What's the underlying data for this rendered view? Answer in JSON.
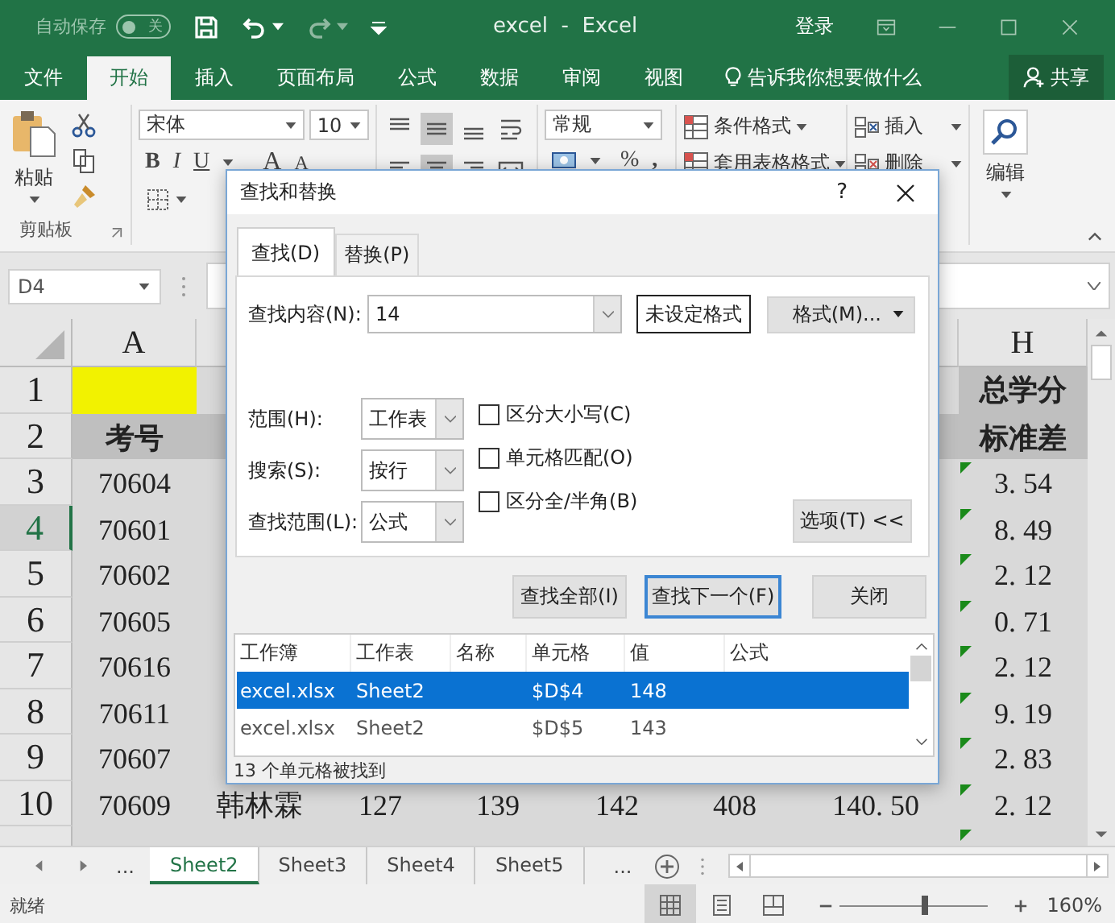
{
  "autosave": {
    "label": "自动保存",
    "on": false,
    "state_text": "关"
  },
  "window": {
    "title": "excel  -  Excel",
    "sign_in": "登录"
  },
  "tabs": [
    {
      "label": "文件",
      "selected": false
    },
    {
      "label": "开始",
      "selected": true
    },
    {
      "label": "插入",
      "selected": false
    },
    {
      "label": "页面布局",
      "selected": false
    },
    {
      "label": "公式",
      "selected": false
    },
    {
      "label": "数据",
      "selected": false
    },
    {
      "label": "审阅",
      "selected": false
    },
    {
      "label": "视图",
      "selected": false
    }
  ],
  "tell_me": "告诉我你想要做什么",
  "share": "共享",
  "ribbon": {
    "paste": "粘贴",
    "clipboard_label": "剪贴板",
    "font": "宋体",
    "font_size": "10",
    "bold": "B",
    "italic": "I",
    "underline": "U",
    "grow": "A",
    "shrink": "A",
    "alignment": [
      {
        "kind": "top",
        "selected": false
      },
      {
        "kind": "middle",
        "selected": true
      },
      {
        "kind": "bottom",
        "selected": false
      },
      {
        "kind": "wrap",
        "selected": false
      },
      {
        "kind": "left",
        "selected": false
      },
      {
        "kind": "center",
        "selected": true
      },
      {
        "kind": "right",
        "selected": false
      },
      {
        "kind": "merge",
        "selected": false
      }
    ],
    "number_format": "常规",
    "percent": "%",
    "comma": ",",
    "styles": [
      "条件格式",
      "套用表格格式"
    ],
    "cells": [
      "插入",
      "删除"
    ],
    "editing": "编辑"
  },
  "name_box": "D4",
  "sheet": {
    "column_headers": {
      "a": "A",
      "h": "H"
    },
    "rows": [
      {
        "number": "1",
        "kind": "title",
        "selected": false,
        "h": "总学分"
      },
      {
        "number": "2",
        "kind": "header",
        "selected": false,
        "a": "考号",
        "h": "标准差"
      },
      {
        "number": "3",
        "kind": "data",
        "selected": false,
        "a": "70604",
        "h": "3. 54",
        "error_mark": true
      },
      {
        "number": "4",
        "kind": "data",
        "selected": true,
        "a": "70601",
        "h": "8. 49",
        "error_mark": true
      },
      {
        "number": "5",
        "kind": "data",
        "selected": false,
        "a": "70602",
        "h": "2. 12",
        "error_mark": true
      },
      {
        "number": "6",
        "kind": "data",
        "selected": false,
        "a": "70605",
        "h": "0. 71",
        "error_mark": true
      },
      {
        "number": "7",
        "kind": "data",
        "selected": false,
        "a": "70616",
        "h": "2. 12",
        "error_mark": true
      },
      {
        "number": "8",
        "kind": "data",
        "selected": false,
        "a": "70611",
        "h": "9. 19",
        "error_mark": true
      },
      {
        "number": "9",
        "kind": "data",
        "selected": false,
        "a": "70607",
        "h": "2. 83",
        "error_mark": true
      },
      {
        "number": "10",
        "kind": "data",
        "selected": false,
        "a": "70609",
        "b": "韩林霖",
        "c": "127",
        "d": "139",
        "e": "142",
        "f": "408",
        "g": "140. 50",
        "h": "2. 12",
        "error_mark": true
      },
      {
        "kind": "data",
        "selected": false,
        "error_mark": true
      }
    ]
  },
  "sheet_tabs": [
    {
      "label": "Sheet2",
      "selected": true
    },
    {
      "label": "Sheet3",
      "selected": false
    },
    {
      "label": "Sheet4",
      "selected": false
    },
    {
      "label": "Sheet5",
      "selected": false
    }
  ],
  "tab_overflow": "...",
  "tab_overflow_right": "...",
  "status": {
    "text": "就绪",
    "views": [
      {
        "kind": "normal",
        "selected": true
      },
      {
        "kind": "page_layout",
        "selected": false
      },
      {
        "kind": "page_break",
        "selected": false
      }
    ],
    "zoom_slider": {
      "level": 0.58
    },
    "zoom": "160%"
  },
  "dialog": {
    "title": "查找和替换",
    "help": "?",
    "tabs": [
      {
        "label": "查找(D)",
        "selected": true
      },
      {
        "label": "替换(P)",
        "selected": false
      }
    ],
    "find_label": "查找内容(N):",
    "find_value": "14",
    "format_preview": "未设定格式",
    "format_button": "格式(M)...",
    "options": [
      {
        "label": "范围(H):",
        "value": "工作表"
      },
      {
        "label": "搜索(S):",
        "value": "按行"
      },
      {
        "label": "查找范围(L):",
        "value": "公式"
      }
    ],
    "checkboxes": [
      {
        "label": "区分大小写(C)",
        "checked": false
      },
      {
        "label": "单元格匹配(O)",
        "checked": false
      },
      {
        "label": "区分全/半角(B)",
        "checked": false
      }
    ],
    "options_button": "选项(T) <<",
    "buttons": [
      {
        "label": "查找全部(I)",
        "focused": false
      },
      {
        "label": "查找下一个(F)",
        "focused": true
      },
      {
        "label": "关闭",
        "focused": false
      }
    ],
    "results": {
      "columns": [
        "工作簿",
        "工作表",
        "名称",
        "单元格",
        "值",
        "公式"
      ],
      "rows": [
        {
          "workbook": "excel.xlsx",
          "sheet": "Sheet2",
          "cell": "$D$4",
          "value": "148",
          "selected": true
        },
        {
          "workbook": "excel.xlsx",
          "sheet": "Sheet2",
          "cell": "$D$5",
          "value": "143",
          "selected": false
        }
      ]
    },
    "status": "13 个单元格被找到"
  }
}
